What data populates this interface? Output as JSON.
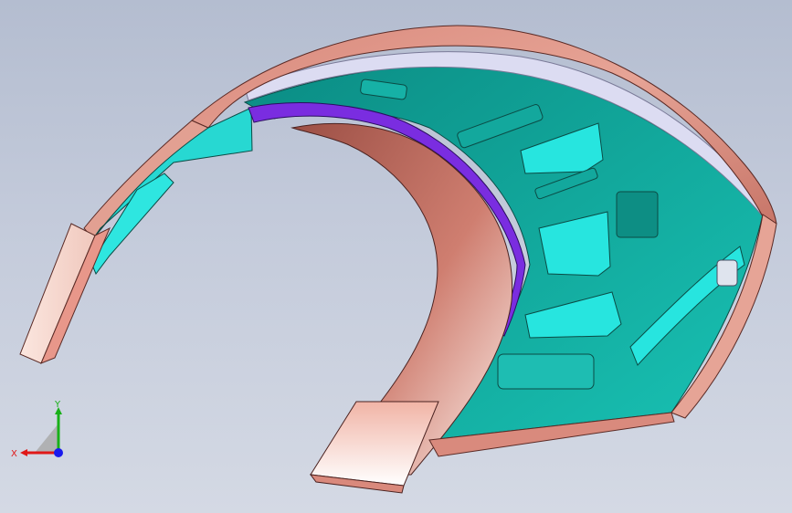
{
  "viewport": {
    "background_top": "#b4bdd0",
    "background_bottom": "#d4d9e4"
  },
  "model": {
    "colors": {
      "shell_salmon": "#e0998a",
      "shell_dark": "#a85a50",
      "shell_light": "#fbe3dc",
      "inner_teal": "#0fa398",
      "inner_teal_dark": "#066f66",
      "inner_cyan": "#27e5df",
      "rib_purple": "#7a2de0",
      "rim_lavender": "#dcdcf2"
    }
  },
  "triad": {
    "x_label": "X",
    "y_label": "Y",
    "x_color": "#e01818",
    "y_color": "#18b018",
    "z_color": "#1a1aee"
  }
}
